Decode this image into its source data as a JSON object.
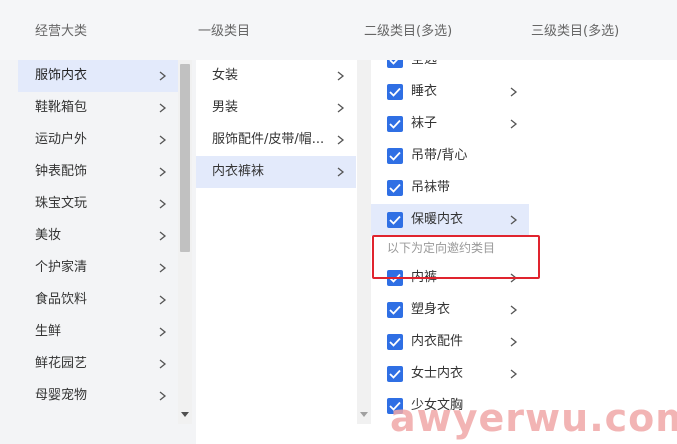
{
  "header": {
    "col1": "经营大类",
    "col2": "一级类目",
    "col3": "二级类目(多选)",
    "col4": "三级类目(多选)"
  },
  "major_categories": [
    {
      "label": "服饰内衣",
      "active": true
    },
    {
      "label": "鞋靴箱包"
    },
    {
      "label": "运动户外"
    },
    {
      "label": "钟表配饰"
    },
    {
      "label": "珠宝文玩"
    },
    {
      "label": "美妆"
    },
    {
      "label": "个护家清"
    },
    {
      "label": "食品饮料"
    },
    {
      "label": "生鲜"
    },
    {
      "label": "鲜花园艺"
    },
    {
      "label": "母婴宠物"
    }
  ],
  "level1": [
    {
      "label": "女装"
    },
    {
      "label": "男装"
    },
    {
      "label": "服饰配件/皮带/帽..."
    },
    {
      "label": "内衣裤袜",
      "active": true
    }
  ],
  "level2": [
    {
      "label": "全选",
      "chevron": false
    },
    {
      "label": "睡衣",
      "chevron": true
    },
    {
      "label": "袜子",
      "chevron": true
    },
    {
      "label": "吊带/背心",
      "chevron": false
    },
    {
      "label": "吊袜带",
      "chevron": false
    },
    {
      "label": "保暖内衣",
      "chevron": true,
      "active": true
    }
  ],
  "invite_notice": "以下为定向邀约类目",
  "level2_invited": [
    {
      "label": "内裤",
      "chevron": true
    },
    {
      "label": "塑身衣",
      "chevron": true
    },
    {
      "label": "内衣配件",
      "chevron": true
    },
    {
      "label": "女士内衣",
      "chevron": true
    },
    {
      "label": "少女文胸",
      "chevron": false
    }
  ],
  "watermark": "awyerwu.com",
  "colors": {
    "accent": "#2f6fe4",
    "active_bg": "#e3eafb",
    "highlight_box": "#e0242e"
  }
}
